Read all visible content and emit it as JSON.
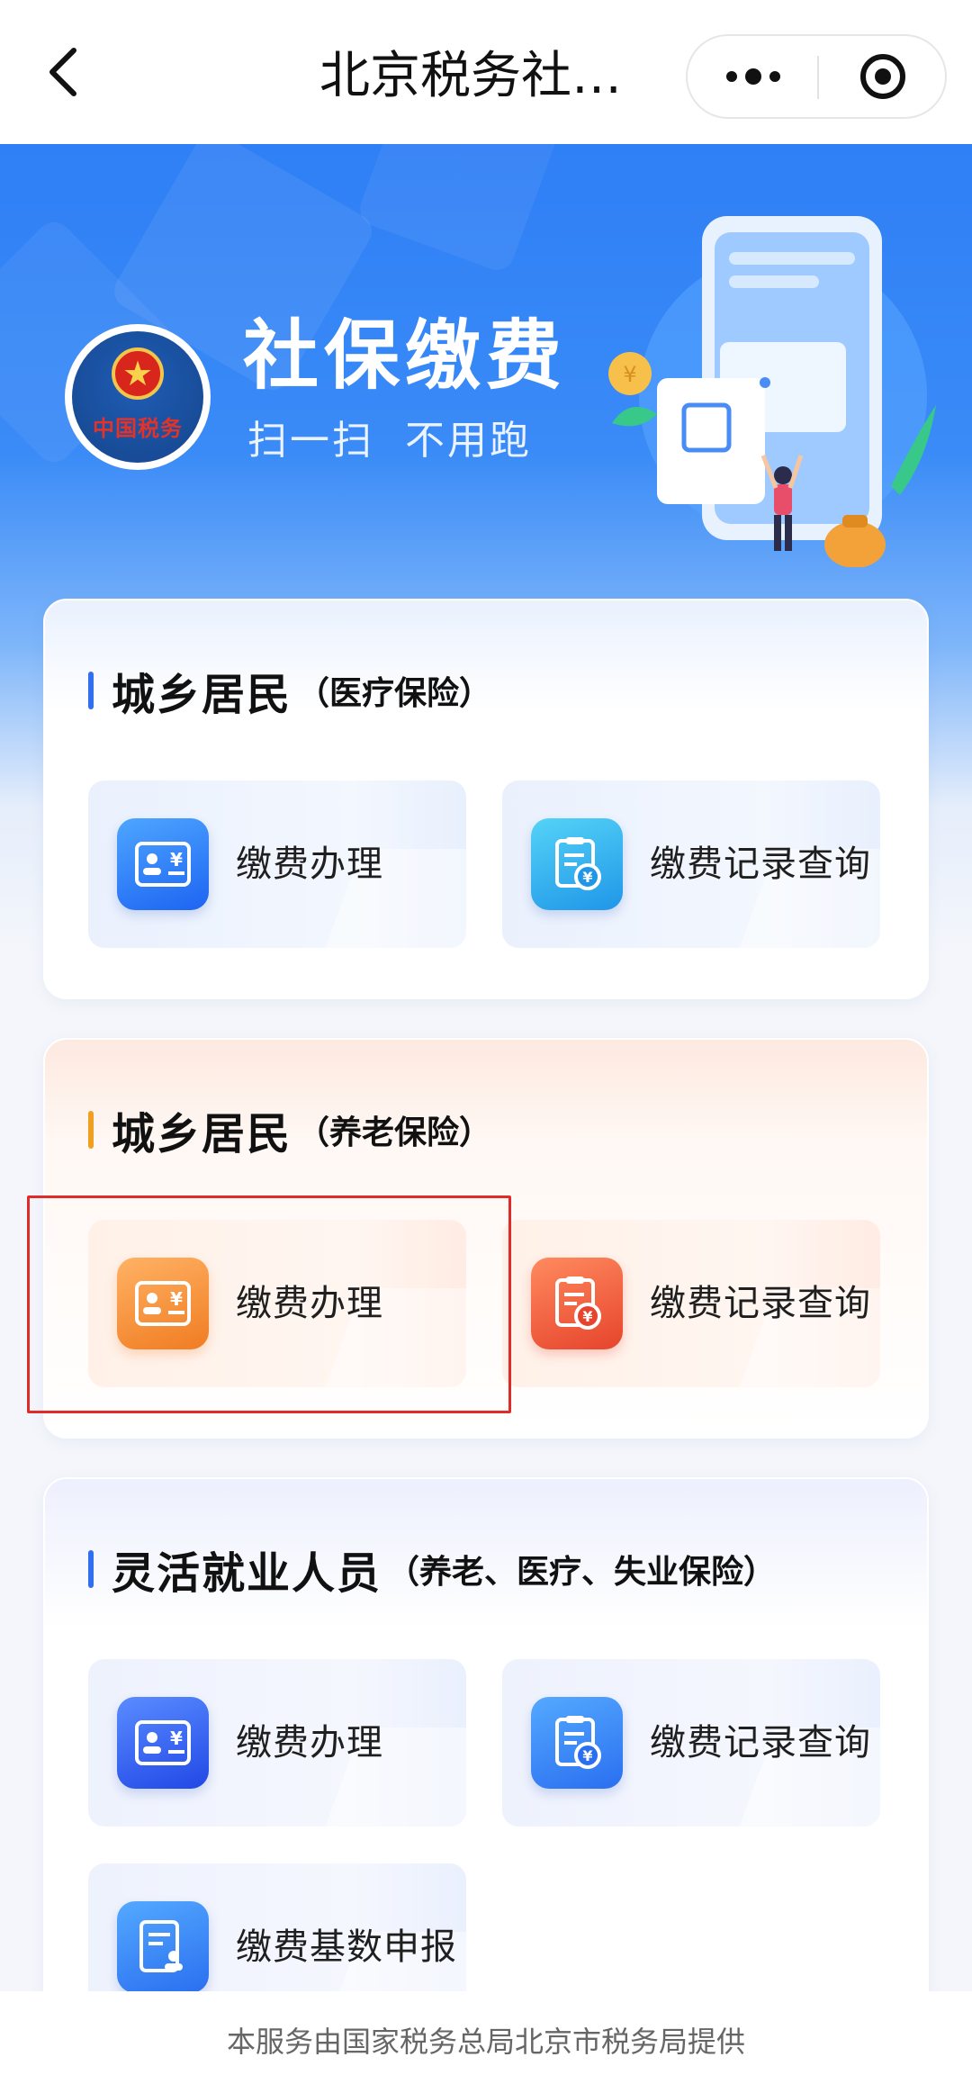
{
  "nav": {
    "title": "北京税务社…"
  },
  "banner": {
    "title": "社保缴费",
    "subtitle": "扫一扫  不用跑",
    "emblem_text": "中国税务"
  },
  "sections": [
    {
      "title": "城乡居民",
      "subtitle": "（医疗保险）",
      "accent": "#2f6ff0",
      "tiles": [
        {
          "label": "缴费办理",
          "icon": "id-card-yen-icon"
        },
        {
          "label": "缴费记录查询",
          "icon": "receipt-yen-icon"
        }
      ]
    },
    {
      "title": "城乡居民",
      "subtitle": "（养老保险）",
      "accent": "#f0a020",
      "tiles": [
        {
          "label": "缴费办理",
          "icon": "id-card-yen-icon"
        },
        {
          "label": "缴费记录查询",
          "icon": "receipt-yen-icon"
        }
      ]
    },
    {
      "title": "灵活就业人员",
      "subtitle": "（养老、医疗、失业保险）",
      "accent": "#2f6ff0",
      "tiles": [
        {
          "label": "缴费办理",
          "icon": "id-card-yen-icon"
        },
        {
          "label": "缴费记录查询",
          "icon": "receipt-yen-icon"
        },
        {
          "label": "缴费基数申报",
          "icon": "form-person-icon"
        }
      ]
    }
  ],
  "footer": {
    "text": "本服务由国家税务总局北京市税务局提供"
  },
  "colors": {
    "primary_blue": "#2f7ff6",
    "highlight_red": "#e02b2b"
  }
}
